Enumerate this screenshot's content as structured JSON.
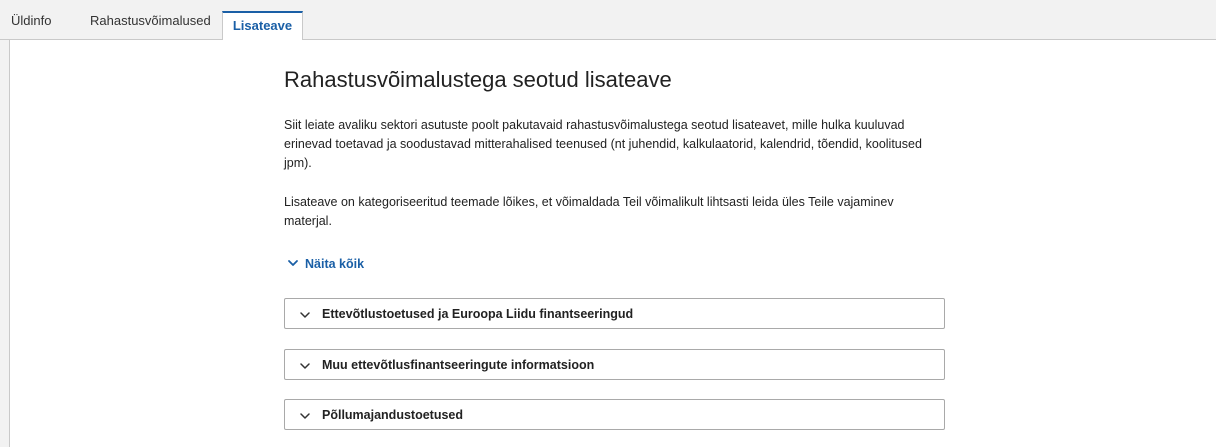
{
  "tabs": [
    {
      "label": "Üldinfo",
      "active": false
    },
    {
      "label": "Rahastusvõimalused",
      "active": false
    },
    {
      "label": "Lisateave",
      "active": true
    }
  ],
  "main": {
    "title": "Rahastusvõimalustega seotud lisateave",
    "paragraphs": [
      "Siit leiate avaliku sektori asutuste poolt pakutavaid rahastusvõimalustega seotud lisateavet, mille hulka kuuluvad erinevad toetavad ja soodustavad mitterahalised teenused (nt juhendid, kalkulaatorid, kalendrid, tõendid, koolitused jpm).",
      "Lisateave on kategoriseeritud teemade lõikes, et võimaldada Teil võimalikult lihtsasti leida üles Teile vajaminev materjal."
    ],
    "show_all_label": "Näita kõik",
    "accordions": [
      {
        "label": "Ettevõtlustoetused ja Euroopa Liidu finantseeringud",
        "icon": "chevron-down-icon"
      },
      {
        "label": "Muu ettevõtlusfinantseeringute informatsioon",
        "icon": "chevron-down-icon"
      },
      {
        "label": "Põllumajandustoetused",
        "icon": "chevron-down-icon"
      }
    ]
  },
  "colors": {
    "accent": "#1a5fa6",
    "background": "#f2f2f2",
    "border": "#c9c9c9"
  }
}
